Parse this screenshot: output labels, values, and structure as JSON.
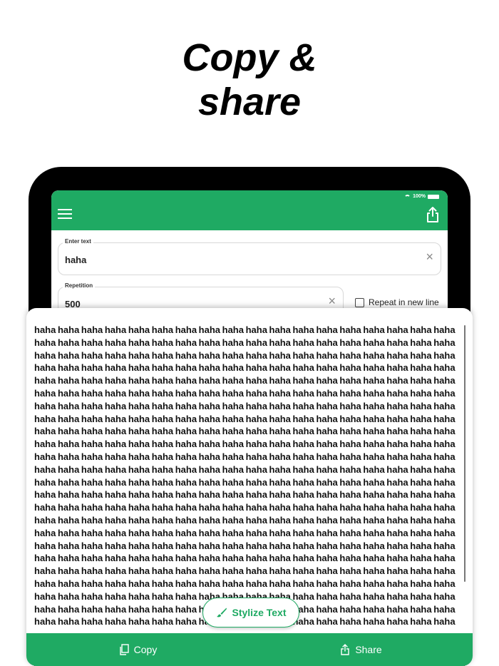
{
  "headline": {
    "line1": "Copy &",
    "line2": "share"
  },
  "status_bar": {
    "battery": "100%"
  },
  "icons": {
    "menu": "menu-icon",
    "share_top": "share-icon",
    "wifi": "wifi-icon",
    "battery": "battery-icon",
    "clear": "close-icon",
    "brush": "brush-icon",
    "copy": "copy-icon",
    "share": "share-icon"
  },
  "input": {
    "label": "Enter text",
    "value": "haha"
  },
  "repetition": {
    "label": "Repetition",
    "value": "500",
    "repeat_new_line_label": "Repeat in new line",
    "repeat_new_line_checked": false
  },
  "result": {
    "word": "haha",
    "words_per_line": 18,
    "lines_shown": 24
  },
  "buttons": {
    "stylize": "Stylize Text",
    "copy": "Copy",
    "share": "Share"
  },
  "colors": {
    "accent": "#1faa63",
    "frame": "#000000"
  }
}
